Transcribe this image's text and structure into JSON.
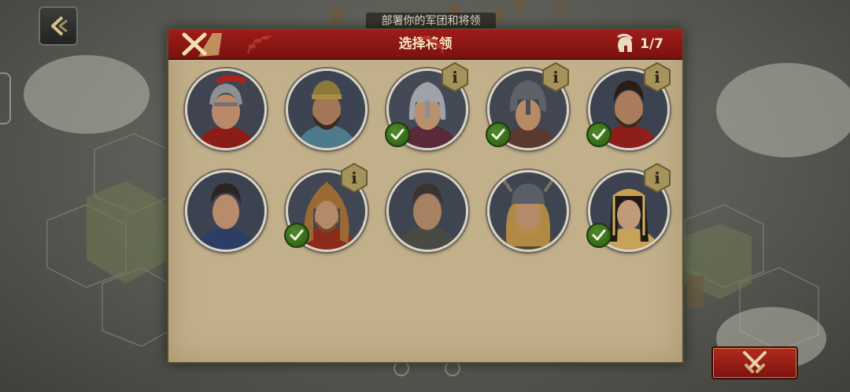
{
  "banner_text": "部署你的军团和将领",
  "dialog": {
    "title": "选择将领",
    "count": "1/7"
  },
  "commanders": [
    {
      "name": "commander-roman-legatus",
      "info": false,
      "selected": false
    },
    {
      "name": "commander-bearded-warrior",
      "info": false,
      "selected": false
    },
    {
      "name": "commander-steel-helmet",
      "info": true,
      "selected": true
    },
    {
      "name": "commander-eastern-helmet",
      "info": true,
      "selected": true
    },
    {
      "name": "commander-bearded-general",
      "info": true,
      "selected": true
    },
    {
      "name": "commander-young-officer",
      "info": false,
      "selected": false
    },
    {
      "name": "commander-lion-pelt",
      "info": true,
      "selected": true
    },
    {
      "name": "commander-veteran",
      "info": false,
      "selected": false
    },
    {
      "name": "commander-viking",
      "info": false,
      "selected": false
    },
    {
      "name": "commander-egyptian-queen",
      "info": true,
      "selected": true
    }
  ],
  "icons": {
    "back": "back-arrow-icon",
    "close": "close-icon",
    "counter": "spartan-helmet-icon",
    "info": "info-icon",
    "check": "check-icon",
    "battle": "crossed-swords-icon"
  },
  "colors": {
    "header_red": "#8c1814",
    "panel_tan": "#c2b08b",
    "badge_gold": "#9b8a55",
    "check_green": "#3d7020"
  }
}
